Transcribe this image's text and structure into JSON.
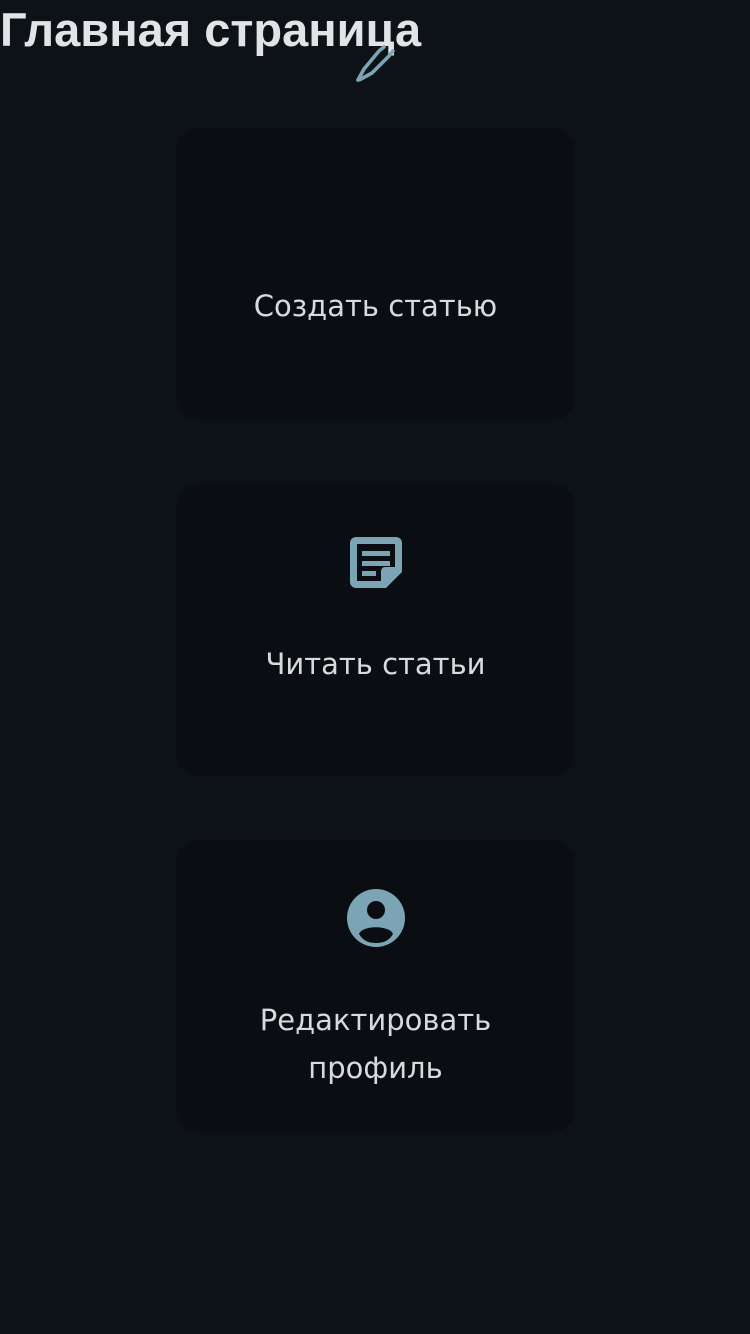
{
  "header": {
    "title": "Главная страница"
  },
  "theme": {
    "background": "#0d1216",
    "card_background": "#0a0e12",
    "icon_color": "#7ba4b5",
    "text_color": "#d9dadd"
  },
  "cards": [
    {
      "icon": "pen-icon",
      "label": "Создать статью"
    },
    {
      "icon": "note-icon",
      "label": "Читать статьи"
    },
    {
      "icon": "account-circle-icon",
      "label": "Редактировать профиль"
    }
  ]
}
